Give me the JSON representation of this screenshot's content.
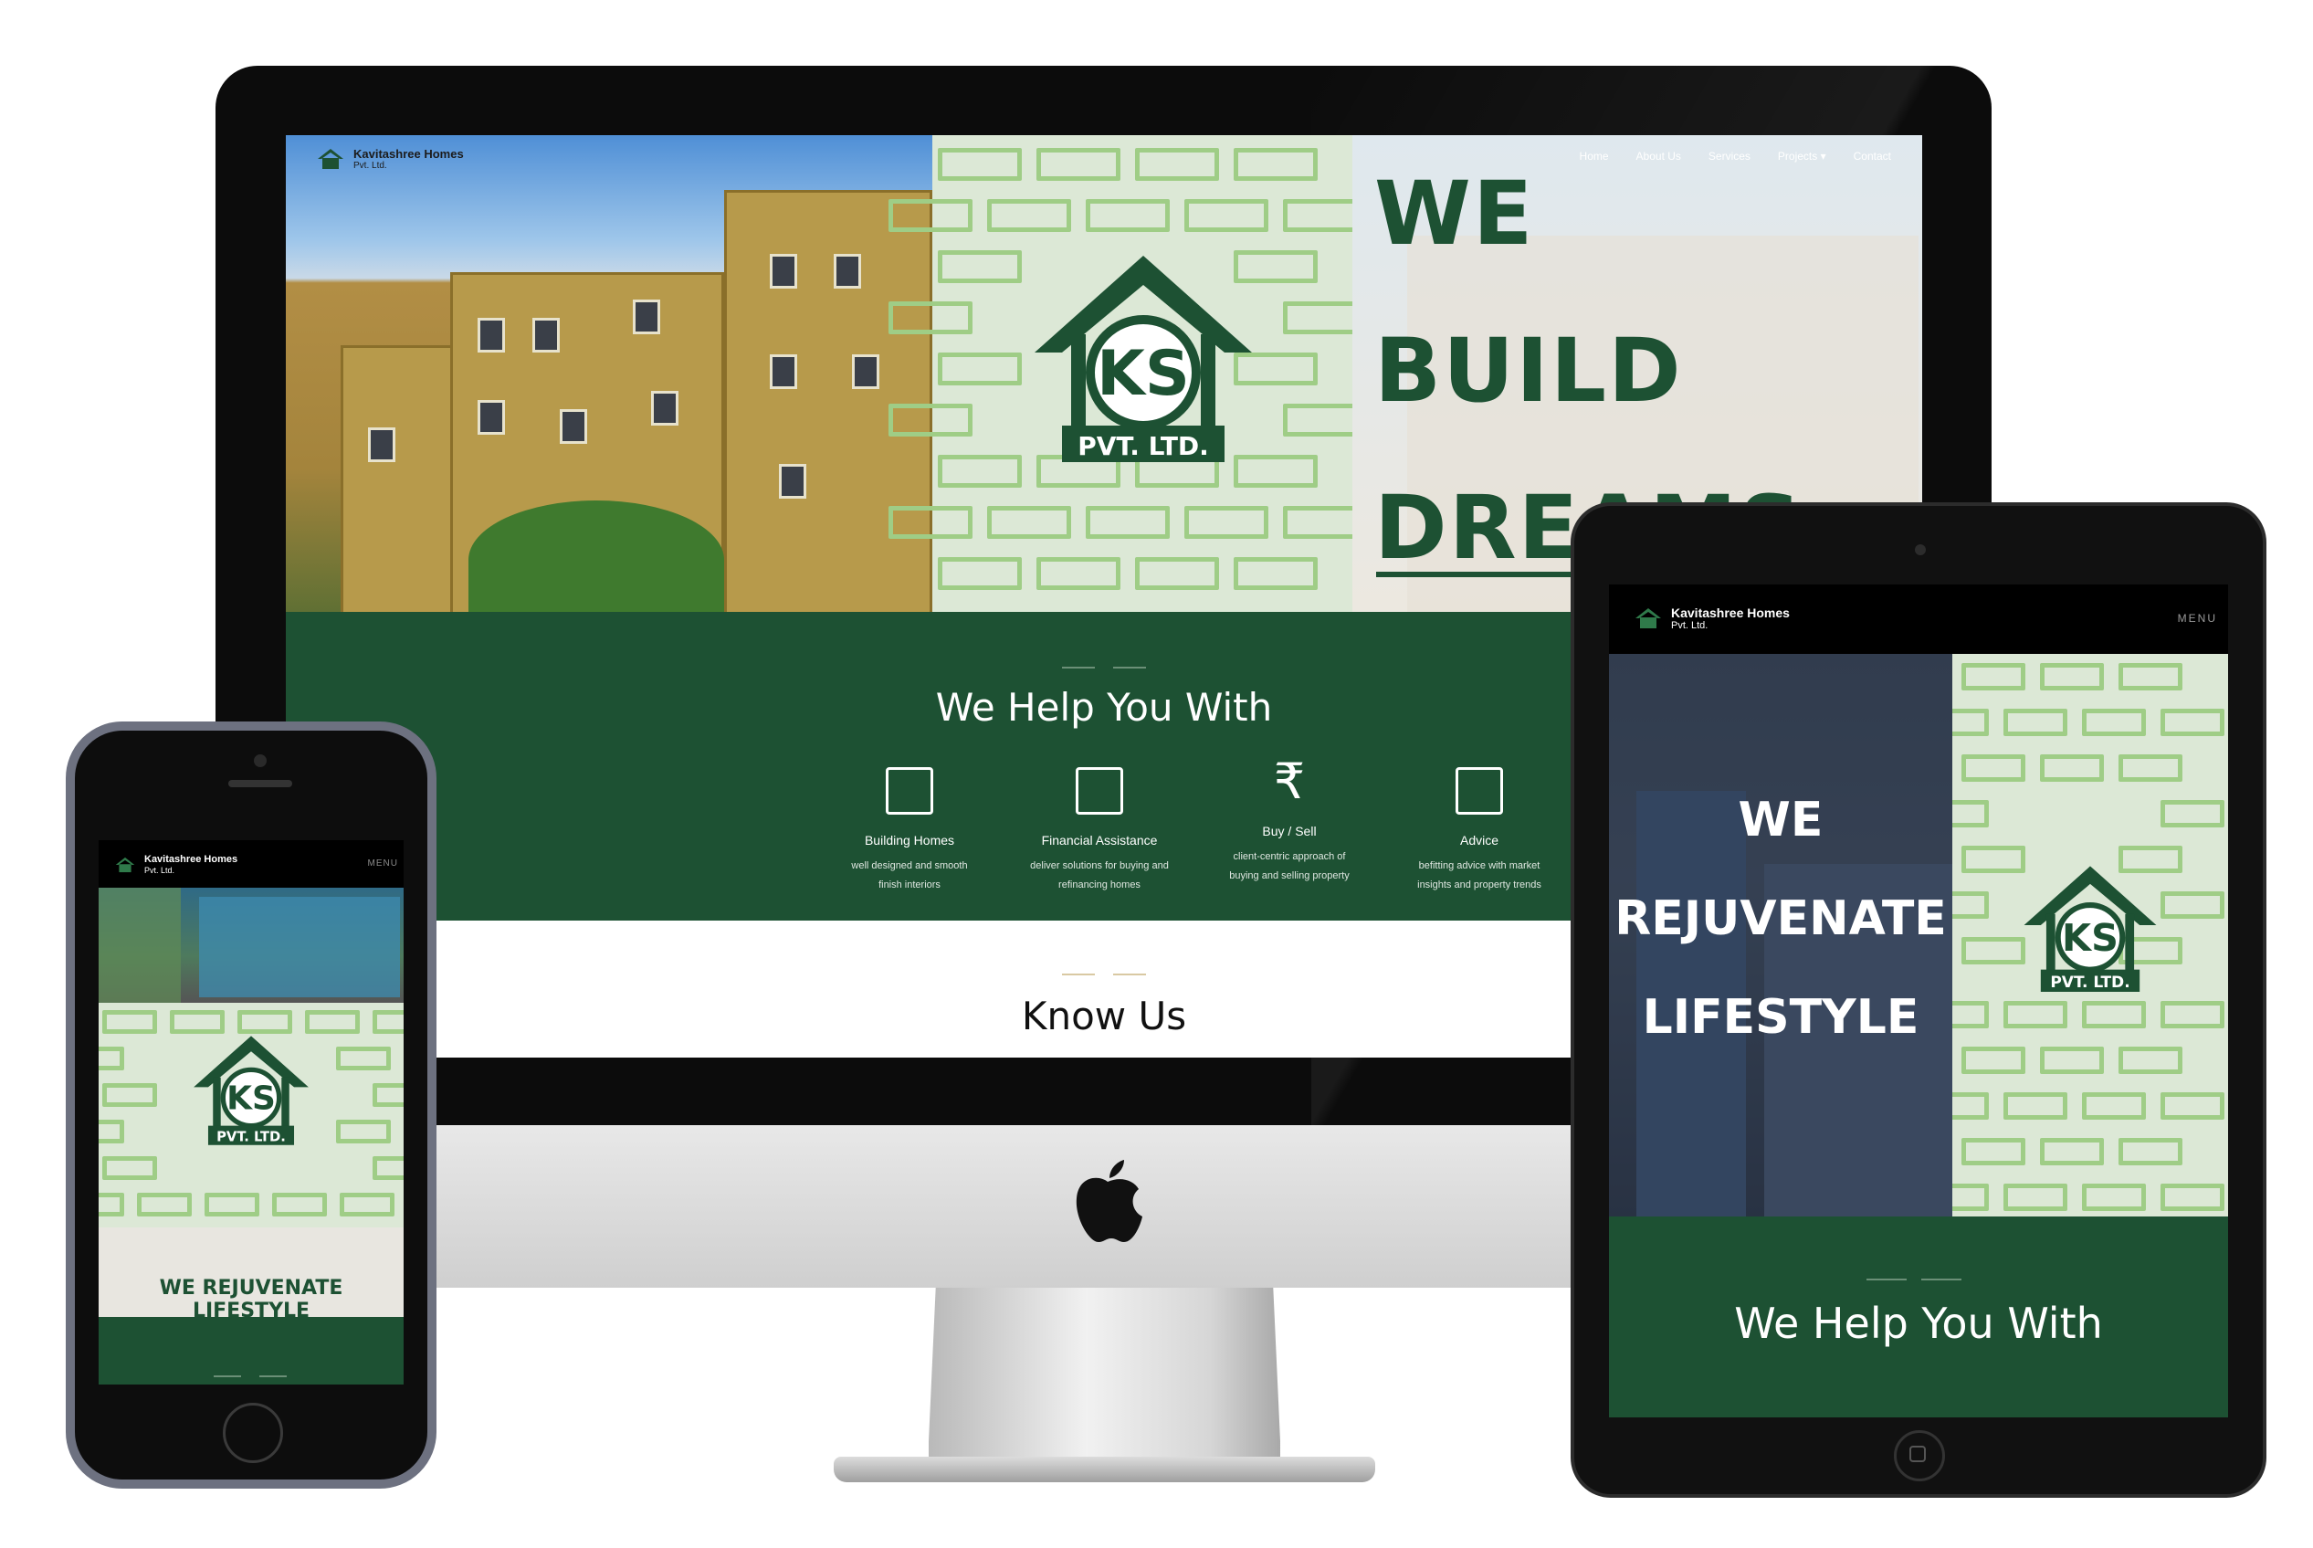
{
  "brand": {
    "name": "Kavitashree Homes",
    "sub": "Pvt. Ltd.",
    "logo_text": "PVT. LTD.",
    "logo_initials": "KS"
  },
  "colors": {
    "brand_green": "#1d5133",
    "brick_green": "#9fcd86",
    "white": "#ffffff"
  },
  "desktop": {
    "nav": [
      "Home",
      "About Us",
      "Services",
      "Projects ▾",
      "Contact"
    ],
    "hero_words": [
      "WE",
      "BUILD",
      "DREAMS"
    ],
    "services_title": "We Help You With",
    "services": [
      {
        "icon": "building-icon",
        "label": "Building Homes",
        "desc": [
          "well designed and smooth",
          "finish interiors"
        ]
      },
      {
        "icon": "finance-icon",
        "label": "Financial Assistance",
        "desc": [
          "deliver solutions for buying and",
          "refinancing homes"
        ]
      },
      {
        "icon": "rupee-icon",
        "label": "Buy / Sell",
        "desc": [
          "client-centric approach of",
          "buying and selling property"
        ]
      },
      {
        "icon": "blueprint-icon",
        "label": "Advice",
        "desc": [
          "befitting advice with market",
          "insights and property trends"
        ]
      }
    ],
    "know_title": "Know Us"
  },
  "tablet": {
    "menu": "MENU",
    "hero_words": [
      "WE",
      "REJUVENATE",
      "LIFESTYLE"
    ],
    "services_title": "We Help You With"
  },
  "phone": {
    "menu": "MENU",
    "caption": "WE REJUVENATE LIFESTYLE"
  }
}
